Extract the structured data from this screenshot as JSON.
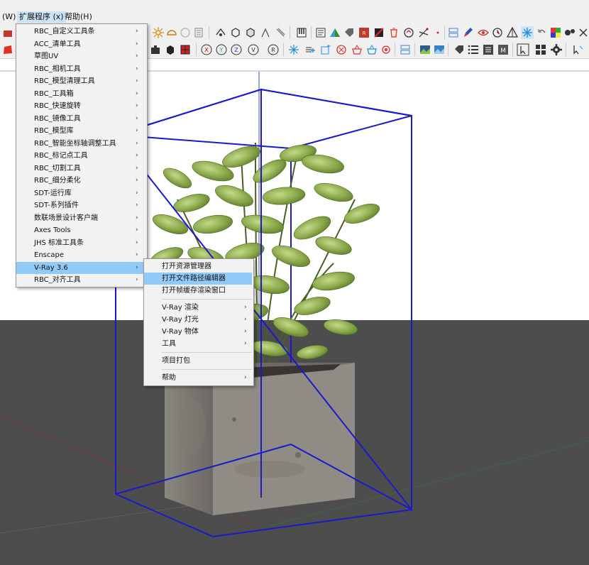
{
  "menubar": {
    "items": [
      {
        "label": "(W)"
      },
      {
        "label": "扩展程序 (x)",
        "active": true
      },
      {
        "label": "帮助(H)"
      }
    ]
  },
  "extensions_menu": {
    "items": [
      {
        "label": "RBC_自定义工具条",
        "submenu": true
      },
      {
        "label": "ACC_清单工具",
        "submenu": true
      },
      {
        "label": "草图UV",
        "submenu": true
      },
      {
        "label": "RBC_相机工具",
        "submenu": true
      },
      {
        "label": "RBC_模型清理工具",
        "submenu": true
      },
      {
        "label": "RBC_工具箱",
        "submenu": true
      },
      {
        "label": "RBC_快速旋转",
        "submenu": true
      },
      {
        "label": "RBC_镜像工具",
        "submenu": true
      },
      {
        "label": "RBC_模型库",
        "submenu": true
      },
      {
        "label": "RBC_智能坐标轴调整工具",
        "submenu": true
      },
      {
        "label": "RBC_标记点工具",
        "submenu": true
      },
      {
        "label": "RBC_切割工具",
        "submenu": true
      },
      {
        "label": "RBC_细分柔化",
        "submenu": true
      },
      {
        "label": "SDT-运行库",
        "submenu": true
      },
      {
        "label": "SDT-系列插件",
        "submenu": true
      },
      {
        "label": "数联场景设计客户端",
        "submenu": true
      },
      {
        "label": "Axes Tools",
        "submenu": true
      },
      {
        "label": "JHS 标准工具条",
        "submenu": true
      },
      {
        "label": "Enscape",
        "submenu": true
      },
      {
        "label": "V-Ray 3.6",
        "submenu": true,
        "highlighted": true
      },
      {
        "label": "RBC_对齐工具",
        "submenu": true
      }
    ]
  },
  "vray_submenu": {
    "items": [
      {
        "label": "打开资源管理器",
        "submenu": false
      },
      {
        "label": "打开文件路径编辑器",
        "submenu": false,
        "highlighted": true
      },
      {
        "label": "打开帧缓存渲染窗口",
        "submenu": false
      },
      {
        "separator": true
      },
      {
        "label": "V-Ray 渲染",
        "submenu": true
      },
      {
        "label": "V-Ray 灯光",
        "submenu": true
      },
      {
        "label": "V-Ray 物体",
        "submenu": true
      },
      {
        "label": "工具",
        "submenu": true
      },
      {
        "separator": true
      },
      {
        "label": "项目打包",
        "submenu": false
      },
      {
        "separator": true
      },
      {
        "label": "帮助",
        "submenu": true
      }
    ]
  },
  "submenu_arrow": "›",
  "colors": {
    "menu_highlight": "#91c9f7",
    "menubar_active": "#cce4f7",
    "bounding_box": "#1a1acc",
    "ground": "#4d4d4d",
    "sky": "#ffffff",
    "foliage": "#8aa84a",
    "pot": "#8e8b84"
  },
  "toolbar_row1_icons": [
    "pushpull-icon",
    "sun-icon",
    "cube-orbit-icon",
    "sphere-icon",
    "shield-icon",
    "box-tool-icon",
    "group-icon",
    "paint-tool-icon",
    "component-icon",
    "piano-icon",
    "report-icon",
    "layers-icon",
    "tag-icon",
    "vr-badge-icon",
    "red-cube-icon",
    "trash-icon",
    "rotate-x-icon",
    "axis-icon",
    "dot-icon",
    "figure-icon",
    "brush-icon",
    "eye-icon",
    "clock-icon",
    "triangle-icon",
    "snowflake-icon",
    "undo-icon",
    "palette-icon",
    "film-icon",
    "settings-icon"
  ],
  "toolbar_row2_icons": [
    "red-shape-icon",
    "chart-icon",
    "puzzle-icon",
    "black-cube-icon",
    "red-box-icon",
    "rotate-x-axis-icon",
    "rotate-y-axis-icon",
    "rotate-z-axis-icon",
    "rotate-v-icon",
    "rotate-r-icon",
    "sparkle-icon",
    "list-add-icon",
    "new-shape-icon",
    "close-circle-icon",
    "basket-icon",
    "basket-alt-icon",
    "gear-small-icon",
    "scene-icon",
    "image-icon",
    "image-alt-icon",
    "tag-alt-icon",
    "list-icon",
    "list-alt-icon",
    "material-icon",
    "pointer-icon",
    "grid-icon",
    "gear-icon",
    "arrow-select-icon"
  ]
}
